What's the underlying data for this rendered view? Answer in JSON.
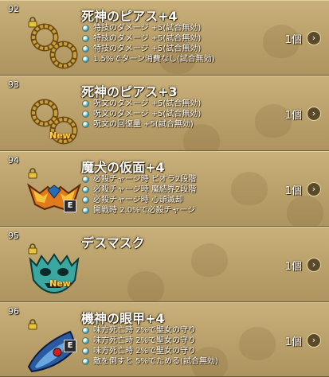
{
  "items": [
    {
      "number": "92",
      "name": "死神のピアス+4",
      "effects": [
        "特技のダメージ +5(試合無効)",
        "特技のダメージ +5(試合無効)",
        "特技のダメージ +5(試合無効)",
        "1.5%でターン消費なし(試合無効)"
      ],
      "quantity": "1個",
      "icon": "reaper-earring-icon",
      "locked": true,
      "new": false,
      "equipped": false
    },
    {
      "number": "93",
      "name": "死神のピアス+3",
      "effects": [
        "呪文のダメージ +5(試合無効)",
        "呪文のダメージ +5(試合無効)",
        "呪文の回復量 +5(試合無効)"
      ],
      "quantity": "1個",
      "icon": "reaper-earring-icon",
      "locked": false,
      "new": true,
      "new_label": "New",
      "equipped": false
    },
    {
      "number": "94",
      "name": "魔犬の仮面+4",
      "effects": [
        "必殺チャージ時 ピオラ2段階",
        "必殺チャージ時 魔結界2段階",
        "必殺チャージ時 心頭滅却",
        "開戦時 2.0%で必殺チャージ"
      ],
      "quantity": "1個",
      "icon": "demon-dog-mask-icon",
      "locked": true,
      "new": false,
      "equipped": true,
      "equipped_label": "E"
    },
    {
      "number": "95",
      "name": "デスマスク",
      "effects": [],
      "quantity": "1個",
      "icon": "death-mask-icon",
      "locked": true,
      "new": true,
      "new_label": "New",
      "equipped": false
    },
    {
      "number": "96",
      "name": "機神の眼甲+4",
      "effects": [
        "味方死亡時 2%で聖女の守り",
        "味方死亡時 2%で聖女の守り",
        "味方死亡時 2%で聖女の守り",
        "敵を倒すと 5%でためる(試合無効)"
      ],
      "quantity": "1個",
      "icon": "machine-god-eyepiece-icon",
      "locked": true,
      "new": false,
      "equipped": true,
      "equipped_label": "E"
    }
  ],
  "colors": {
    "panel": "#b9a06a",
    "name_text": "#ffffff",
    "new_tag": "#ffd34a",
    "lock": "#e8c23a"
  }
}
